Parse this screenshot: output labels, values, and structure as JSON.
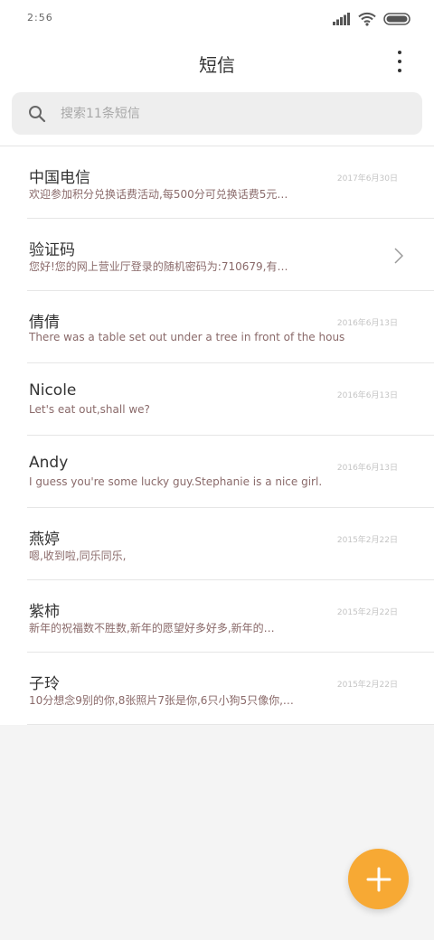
{
  "status": {
    "time": "2:56"
  },
  "header": {
    "title": "短信"
  },
  "search": {
    "placeholder": "搜索11条短信"
  },
  "messages": [
    {
      "name": "中国电信",
      "preview": "欢迎参加积分兑换话费活动,每500分可兑换话费5元…",
      "date": "2017年6月30日",
      "chevron": false
    },
    {
      "name": "验证码",
      "preview": "您好!您的网上营业厅登录的随机密码为:710679,有…",
      "date": "",
      "chevron": true
    },
    {
      "name": "倩倩",
      "preview": "There was a table set out under a tree in front of the hous",
      "date": "2016年6月13日",
      "chevron": false
    },
    {
      "name": "Nicole",
      "preview": "Let's eat out,shall we?",
      "date": "2016年6月13日",
      "chevron": false
    },
    {
      "name": "Andy",
      "preview": "I guess you're some lucky guy.Stephanie is a nice girl.",
      "date": "2016年6月13日",
      "chevron": false
    },
    {
      "name": "燕婷",
      "preview": "嗯,收到啦,同乐同乐,",
      "date": "2015年2月22日",
      "chevron": false
    },
    {
      "name": "紫柿",
      "preview": "新年的祝福数不胜数,新年的愿望好多好多,新年的…",
      "date": "2015年2月22日",
      "chevron": false
    },
    {
      "name": "子玲",
      "preview": "10分想念9别的你,8张照片7张是你,6只小狗5只像你,…",
      "date": "2015年2月22日",
      "chevron": false
    }
  ],
  "fab": {
    "icon": "plus-icon",
    "color": "#f7a934"
  }
}
